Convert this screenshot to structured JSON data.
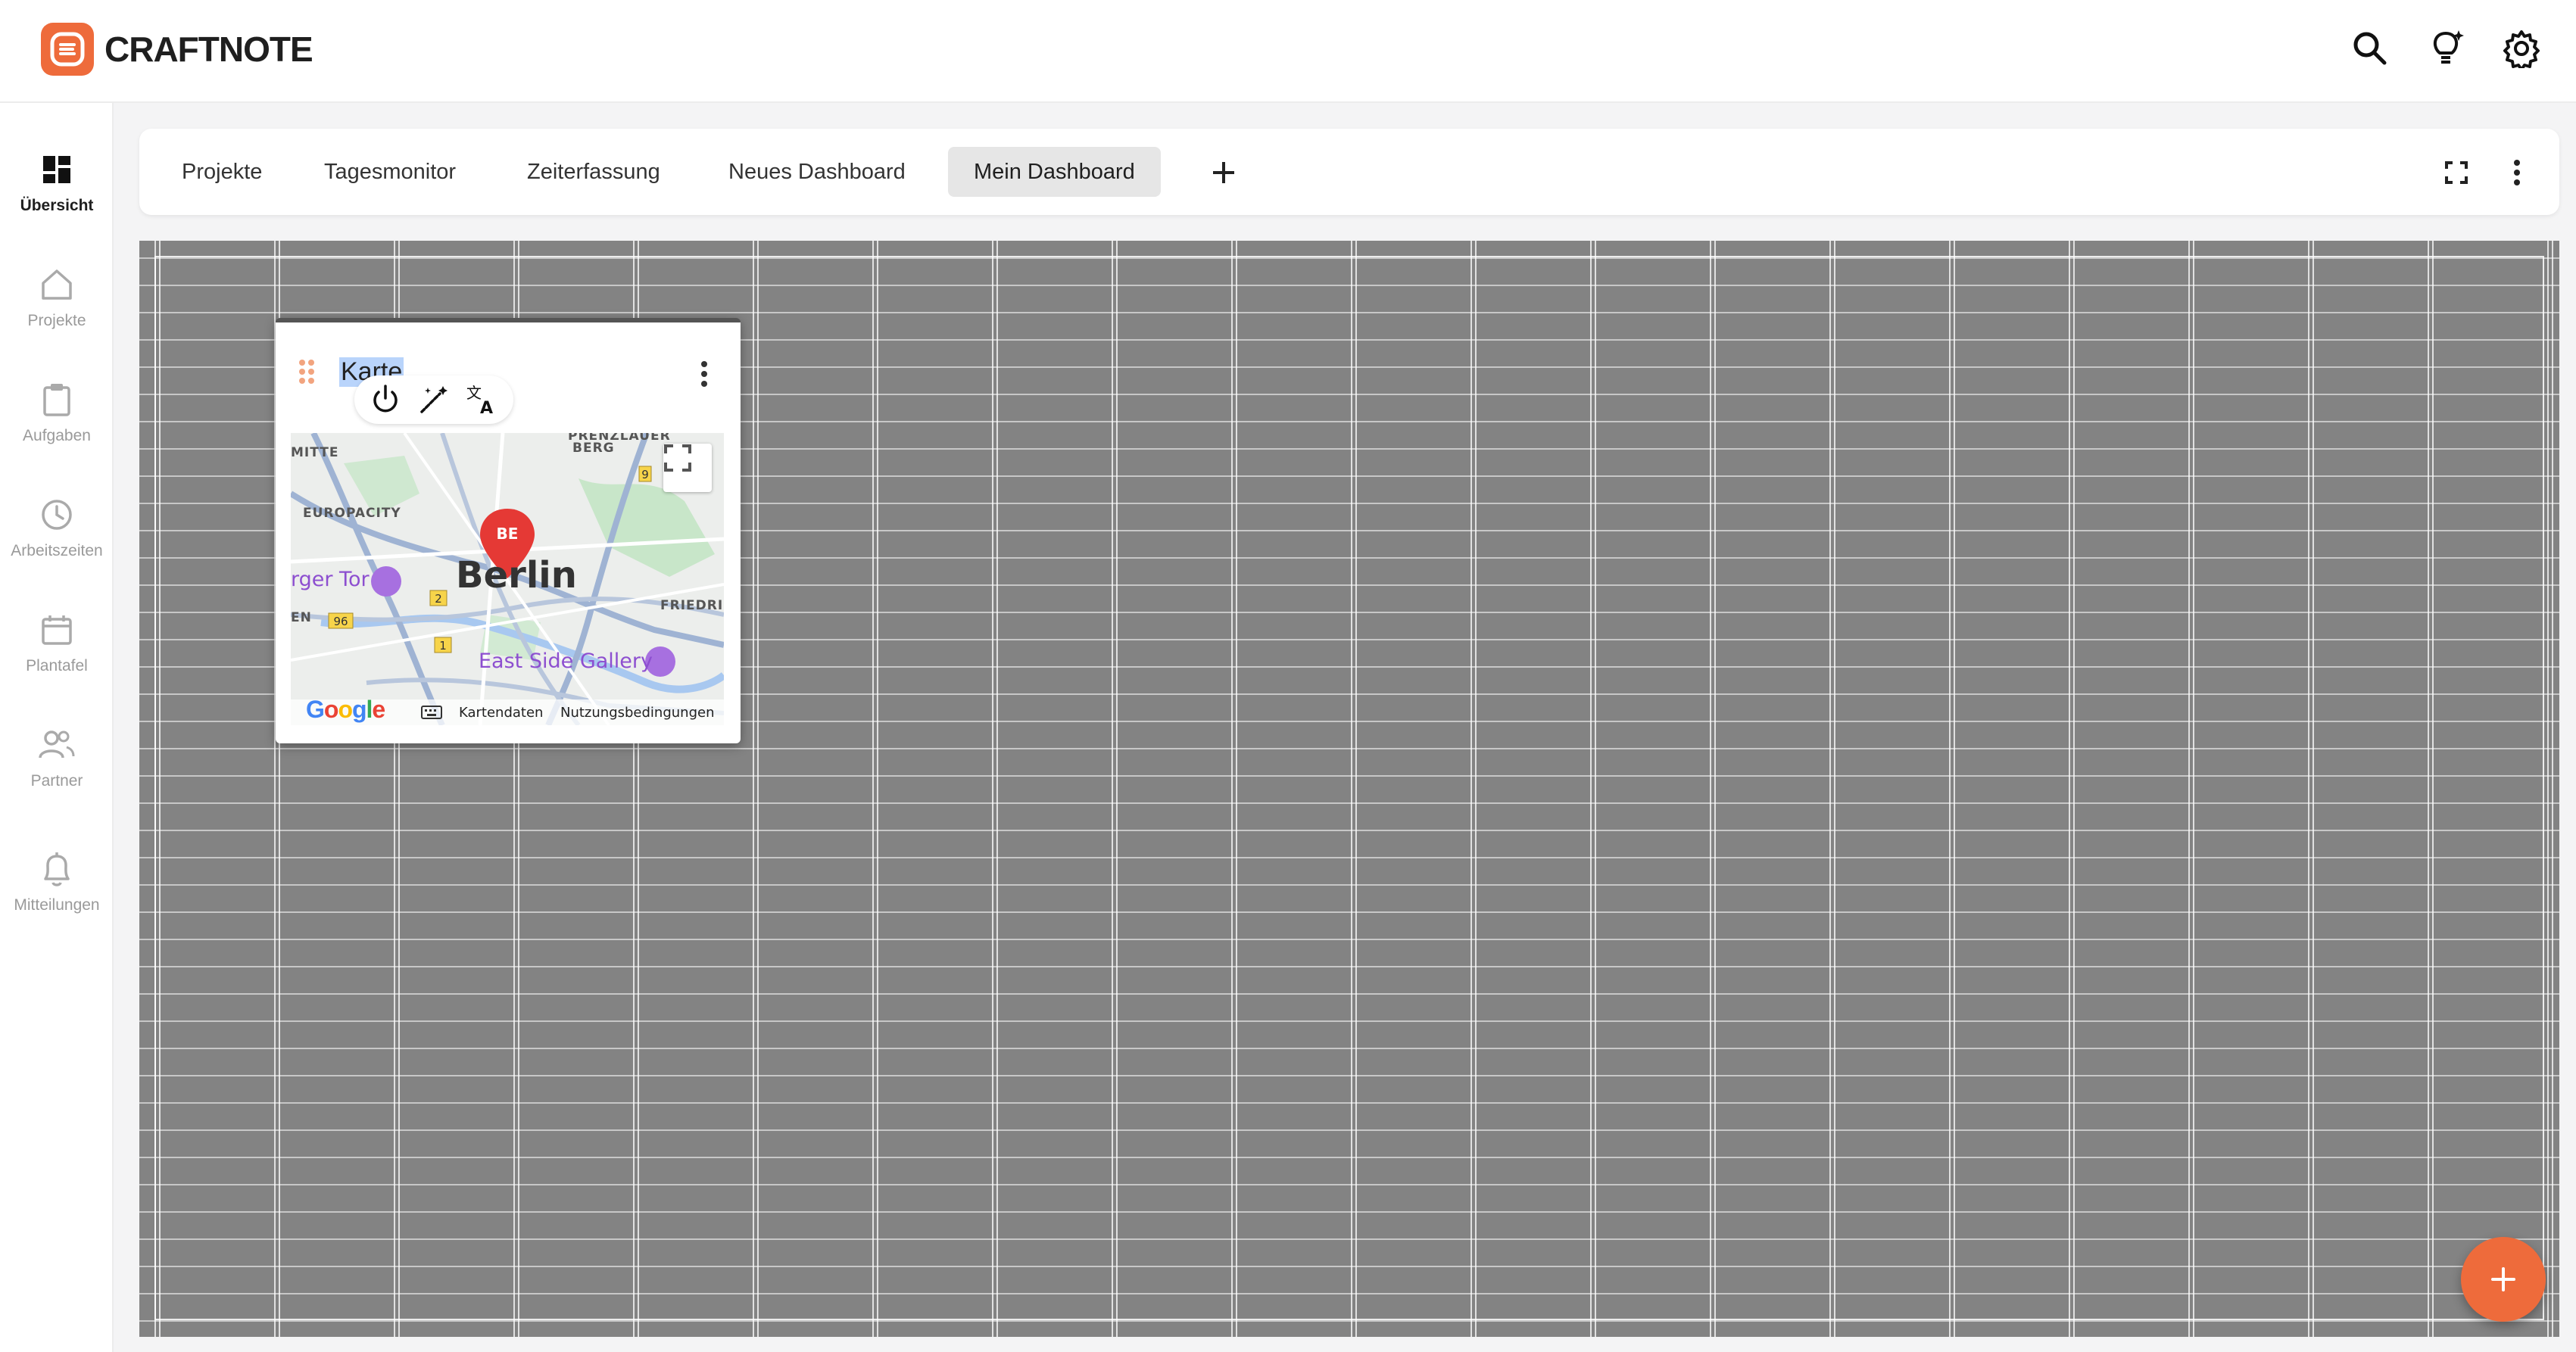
{
  "app": {
    "brand": "CRAFTNOTE",
    "accent_color": "#ee6b3b",
    "top_icons": [
      "search-icon",
      "lightbulb-icon",
      "settings-icon"
    ]
  },
  "sidebar": {
    "items": [
      {
        "label": "Übersicht",
        "icon": "dashboard-icon",
        "active": true
      },
      {
        "label": "Projekte",
        "icon": "home-icon"
      },
      {
        "label": "Aufgaben",
        "icon": "clipboard-icon"
      },
      {
        "label": "Arbeitszeiten",
        "icon": "clock-icon"
      },
      {
        "label": "Plantafel",
        "icon": "calendar-icon"
      },
      {
        "label": "Partner",
        "icon": "people-icon"
      },
      {
        "label": "Mitteilungen",
        "icon": "bell-icon"
      }
    ]
  },
  "tabs": {
    "items": [
      {
        "label": "Projekte"
      },
      {
        "label": "Tagesmonitor"
      },
      {
        "label": "Zeiterfassung"
      },
      {
        "label": "Neues Dashboard"
      },
      {
        "label": "Mein Dashboard",
        "active": true
      }
    ]
  },
  "widget": {
    "title": "Karte",
    "map": {
      "city": "Berlin",
      "marker_label": "BE",
      "districts": [
        "PRENZLAUER",
        "BERG",
        "MITTE",
        "EUROPACITY",
        "FRIEDRI",
        "EN"
      ],
      "pois": [
        "rger Tor",
        "East Side Gallery"
      ],
      "road_shields": [
        "96",
        "2",
        "1",
        "9"
      ],
      "google_logo": "Google",
      "attribution_data": "Kartendaten",
      "attribution_terms": "Nutzungsbedingungen"
    }
  }
}
